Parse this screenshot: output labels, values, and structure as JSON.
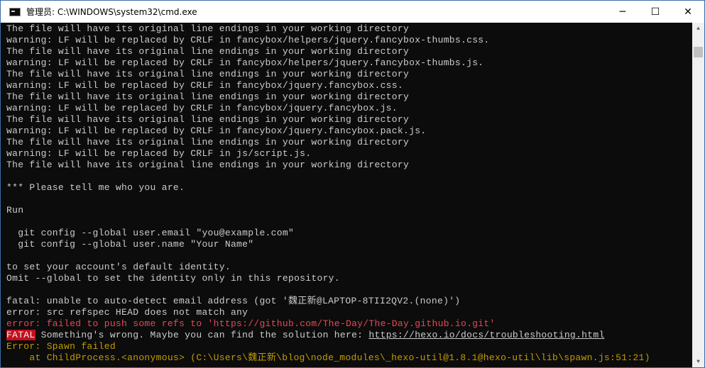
{
  "window": {
    "title": "管理员: C:\\WINDOWS\\system32\\cmd.exe",
    "controls": {
      "minimize": "─",
      "maximize": "☐",
      "close": "✕"
    }
  },
  "scrollbar": {
    "up_arrow": "▲",
    "down_arrow": "▼"
  },
  "console": {
    "lines": [
      "The file will have its original line endings in your working directory",
      "warning: LF will be replaced by CRLF in fancybox/helpers/jquery.fancybox-thumbs.css.",
      "The file will have its original line endings in your working directory",
      "warning: LF will be replaced by CRLF in fancybox/helpers/jquery.fancybox-thumbs.js.",
      "The file will have its original line endings in your working directory",
      "warning: LF will be replaced by CRLF in fancybox/jquery.fancybox.css.",
      "The file will have its original line endings in your working directory",
      "warning: LF will be replaced by CRLF in fancybox/jquery.fancybox.js.",
      "The file will have its original line endings in your working directory",
      "warning: LF will be replaced by CRLF in fancybox/jquery.fancybox.pack.js.",
      "The file will have its original line endings in your working directory",
      "warning: LF will be replaced by CRLF in js/script.js.",
      "The file will have its original line endings in your working directory",
      "",
      "*** Please tell me who you are.",
      "",
      "Run",
      "",
      "  git config --global user.email \"you@example.com\"",
      "  git config --global user.name \"Your Name\"",
      "",
      "to set your account's default identity.",
      "Omit --global to set the identity only in this repository.",
      "",
      "fatal: unable to auto-detect email address (got '魏正新@LAPTOP-8TII2QV2.(none)')",
      "error: src refspec HEAD does not match any"
    ],
    "error_push": "error: failed to push some refs to 'https://github.com/The-Day/The-Day.github.io.git'",
    "fatal_tag": "FATAL",
    "fatal_message": " Something's wrong. Maybe you can find the solution here: ",
    "fatal_link": "https://hexo.io/docs/troubleshooting.html",
    "spawn_error": "Error: Spawn failed",
    "stack_line": "    at ChildProcess.<anonymous> (C:\\Users\\魏正新\\blog\\node_modules\\_hexo-util@1.8.1@hexo-util\\lib\\spawn.js:51:21)"
  }
}
